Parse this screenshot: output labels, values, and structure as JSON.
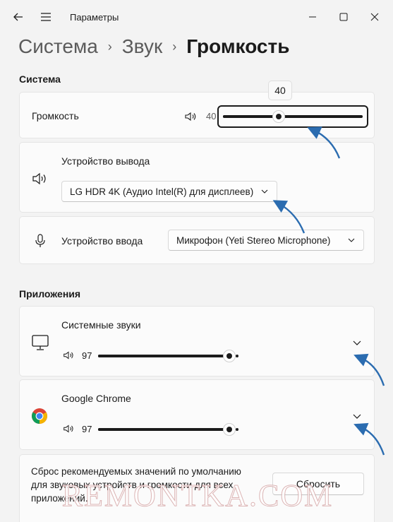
{
  "window": {
    "title": "Параметры"
  },
  "breadcrumb": {
    "items": [
      "Система",
      "Звук"
    ],
    "current": "Громкость"
  },
  "system_section": {
    "title": "Система",
    "volume": {
      "label": "Громкость",
      "value": "40",
      "tooltip": "40",
      "level": 0.4
    },
    "output": {
      "label": "Устройство вывода",
      "device": "LG HDR 4K (Аудио Intel(R) для дисплеев)"
    },
    "input": {
      "label": "Устройство ввода",
      "device": "Микрофон (Yeti Stereo Microphone)"
    }
  },
  "apps_section": {
    "title": "Приложения",
    "apps": [
      {
        "name": "Системные звуки",
        "volume": "97",
        "level": 0.97
      },
      {
        "name": "Google Chrome",
        "volume": "97",
        "level": 0.97
      }
    ]
  },
  "reset": {
    "text": "Сброс рекомендуемых значений по умолчанию для звуковых устройств и громкости для всех приложений.",
    "button_label": "Сбросить"
  },
  "watermark": "REMONTKA.COM",
  "colors": {
    "background": "#f3f3f3",
    "card": "#fbfbfb",
    "annotation_arrow": "#2b6cb0",
    "slider_fill": "#1b1b1b"
  },
  "icons": [
    "back-arrow-icon",
    "hamburger-menu-icon",
    "minimize-icon",
    "maximize-icon",
    "close-icon",
    "speaker-icon",
    "microphone-icon",
    "monitor-icon",
    "chrome-icon",
    "chevron-down-icon",
    "chevron-right-icon"
  ]
}
